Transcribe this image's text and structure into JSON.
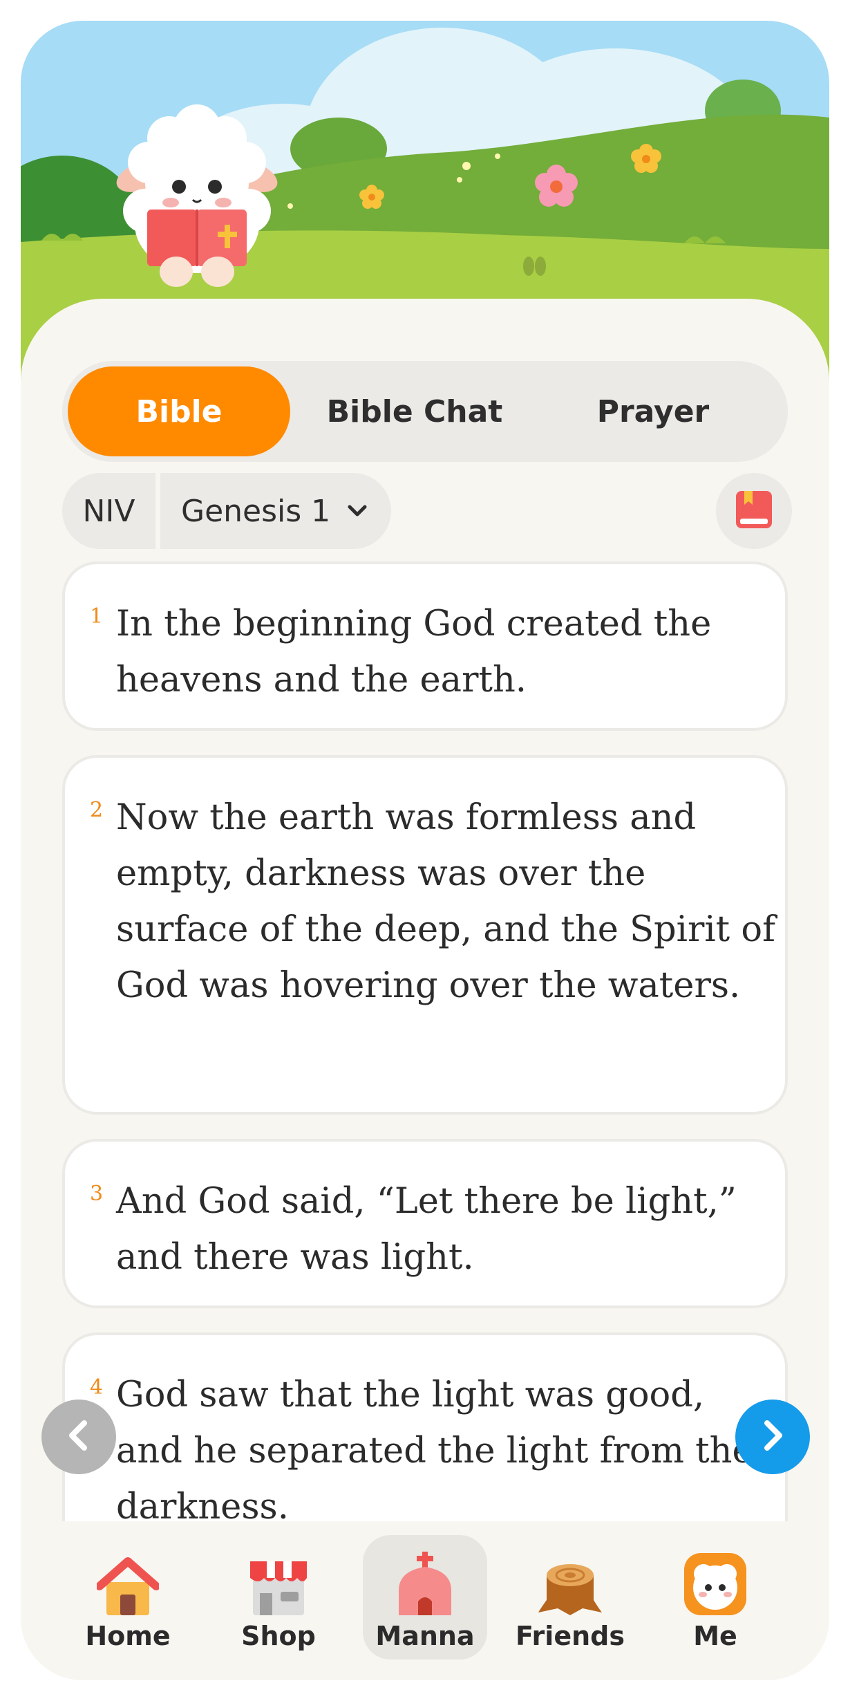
{
  "tabs": [
    {
      "label": "Bible",
      "active": true
    },
    {
      "label": "Bible Chat",
      "active": false
    },
    {
      "label": "Prayer",
      "active": false
    }
  ],
  "reader": {
    "version": "NIV",
    "chapter": "Genesis 1"
  },
  "verses": [
    {
      "num": "1",
      "text": "In the beginning God created the heavens and the earth."
    },
    {
      "num": "2",
      "text": "Now the earth was formless and empty, darkness was over the surface of the deep, and the Spirit of God was hovering over the waters."
    },
    {
      "num": "3",
      "text": "And God said, “Let there be light,” and there was light."
    },
    {
      "num": "4",
      "text": "God saw that the light was good, and he separated the light from the darkness."
    }
  ],
  "bottom_nav": [
    {
      "label": "Home",
      "icon": "house-icon"
    },
    {
      "label": "Shop",
      "icon": "shop-icon"
    },
    {
      "label": "Manna",
      "icon": "church-icon",
      "active": true
    },
    {
      "label": "Friends",
      "icon": "tree-stump-icon"
    },
    {
      "label": "Me",
      "icon": "sheep-avatar-icon"
    }
  ],
  "colors": {
    "accent": "#ff8a00",
    "next_button": "#149bea",
    "prev_button": "#b5b5b5",
    "verse_number": "#f08b1a",
    "background": "#f8f6f1"
  }
}
